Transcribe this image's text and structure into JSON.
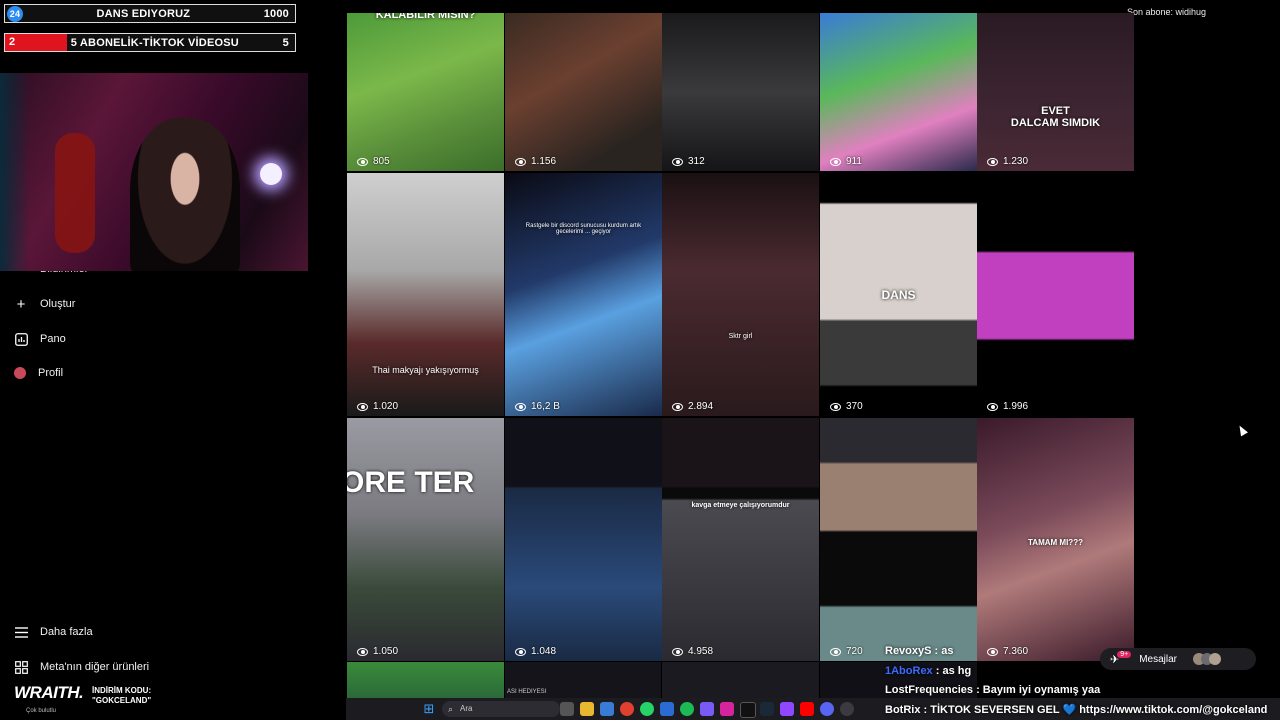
{
  "top_right": {
    "last_sub": "Son abone: widihug"
  },
  "goals": [
    {
      "num": "24",
      "text": "DANS EDIYORUZ",
      "value": "1000",
      "color": "#2d8cf0"
    },
    {
      "num": "2",
      "text": "5 ABONELİK-TİKTOK VİDEOSU",
      "value": "5",
      "color": "#e0141e"
    }
  ],
  "sidebar": {
    "cut_label": "Bildirimler",
    "items": [
      {
        "label": "Oluştur",
        "icon": "plus-icon"
      },
      {
        "label": "Pano",
        "icon": "dashboard-icon"
      },
      {
        "label": "Profil",
        "icon": "avatar-icon"
      }
    ],
    "more": "Daha fazla",
    "meta": "Meta'nın diğer ürünleri"
  },
  "sponsor": {
    "brand": "WRAITH.",
    "code_label": "İNDİRİM KODU:",
    "code": "\"GOKCELAND\"",
    "weather": "Çok bulutlu"
  },
  "tiles": [
    {
      "views": "805",
      "caption": "KALABILIR MISIN?"
    },
    {
      "views": "1.156",
      "caption": ""
    },
    {
      "views": "312",
      "caption": ""
    },
    {
      "views": "911",
      "caption": ""
    },
    {
      "views": "1.230",
      "caption": "EVET\nDALCAM SIMDIK"
    },
    {
      "views": "1.020",
      "caption": "Thai makyajı yakışıyormuş"
    },
    {
      "views": "16,2 B",
      "caption": "Rastgele bir discord sunucusu kurdum artık gecelerimi ... geçiyor"
    },
    {
      "views": "2.894",
      "caption": "Sktr girl"
    },
    {
      "views": "370",
      "caption": "DANS"
    },
    {
      "views": "1.996",
      "caption": ""
    },
    {
      "views": "1.050",
      "caption": "ORE TER"
    },
    {
      "views": "1.048",
      "caption": ""
    },
    {
      "views": "4.958",
      "caption": "kavga etmeye çalışıyorumdur"
    },
    {
      "views": "720",
      "caption": ""
    },
    {
      "views": "7.360",
      "caption": "TAMAM MI???"
    }
  ],
  "chat": [
    {
      "user": "RevoxyS",
      "msg": " : as",
      "color": "#ffffff"
    },
    {
      "user": "1AboRex",
      "msg": " : as hg",
      "color": "#3d6bff"
    },
    {
      "user": "LostFrequencies",
      "msg": " : Bayım iyi oynamış yaa",
      "color": "#ffffff"
    },
    {
      "user": "BotRix",
      "msg": " : TİKTOK SEVERSEN GEL 💙 https://www.tiktok.com/@gokceland",
      "color": "#ffffff"
    }
  ],
  "messages": {
    "label": "Mesajlar",
    "badge": "9+"
  },
  "taskbar": {
    "search": "Ara"
  },
  "row4_label": "ASI HEDIYESI"
}
